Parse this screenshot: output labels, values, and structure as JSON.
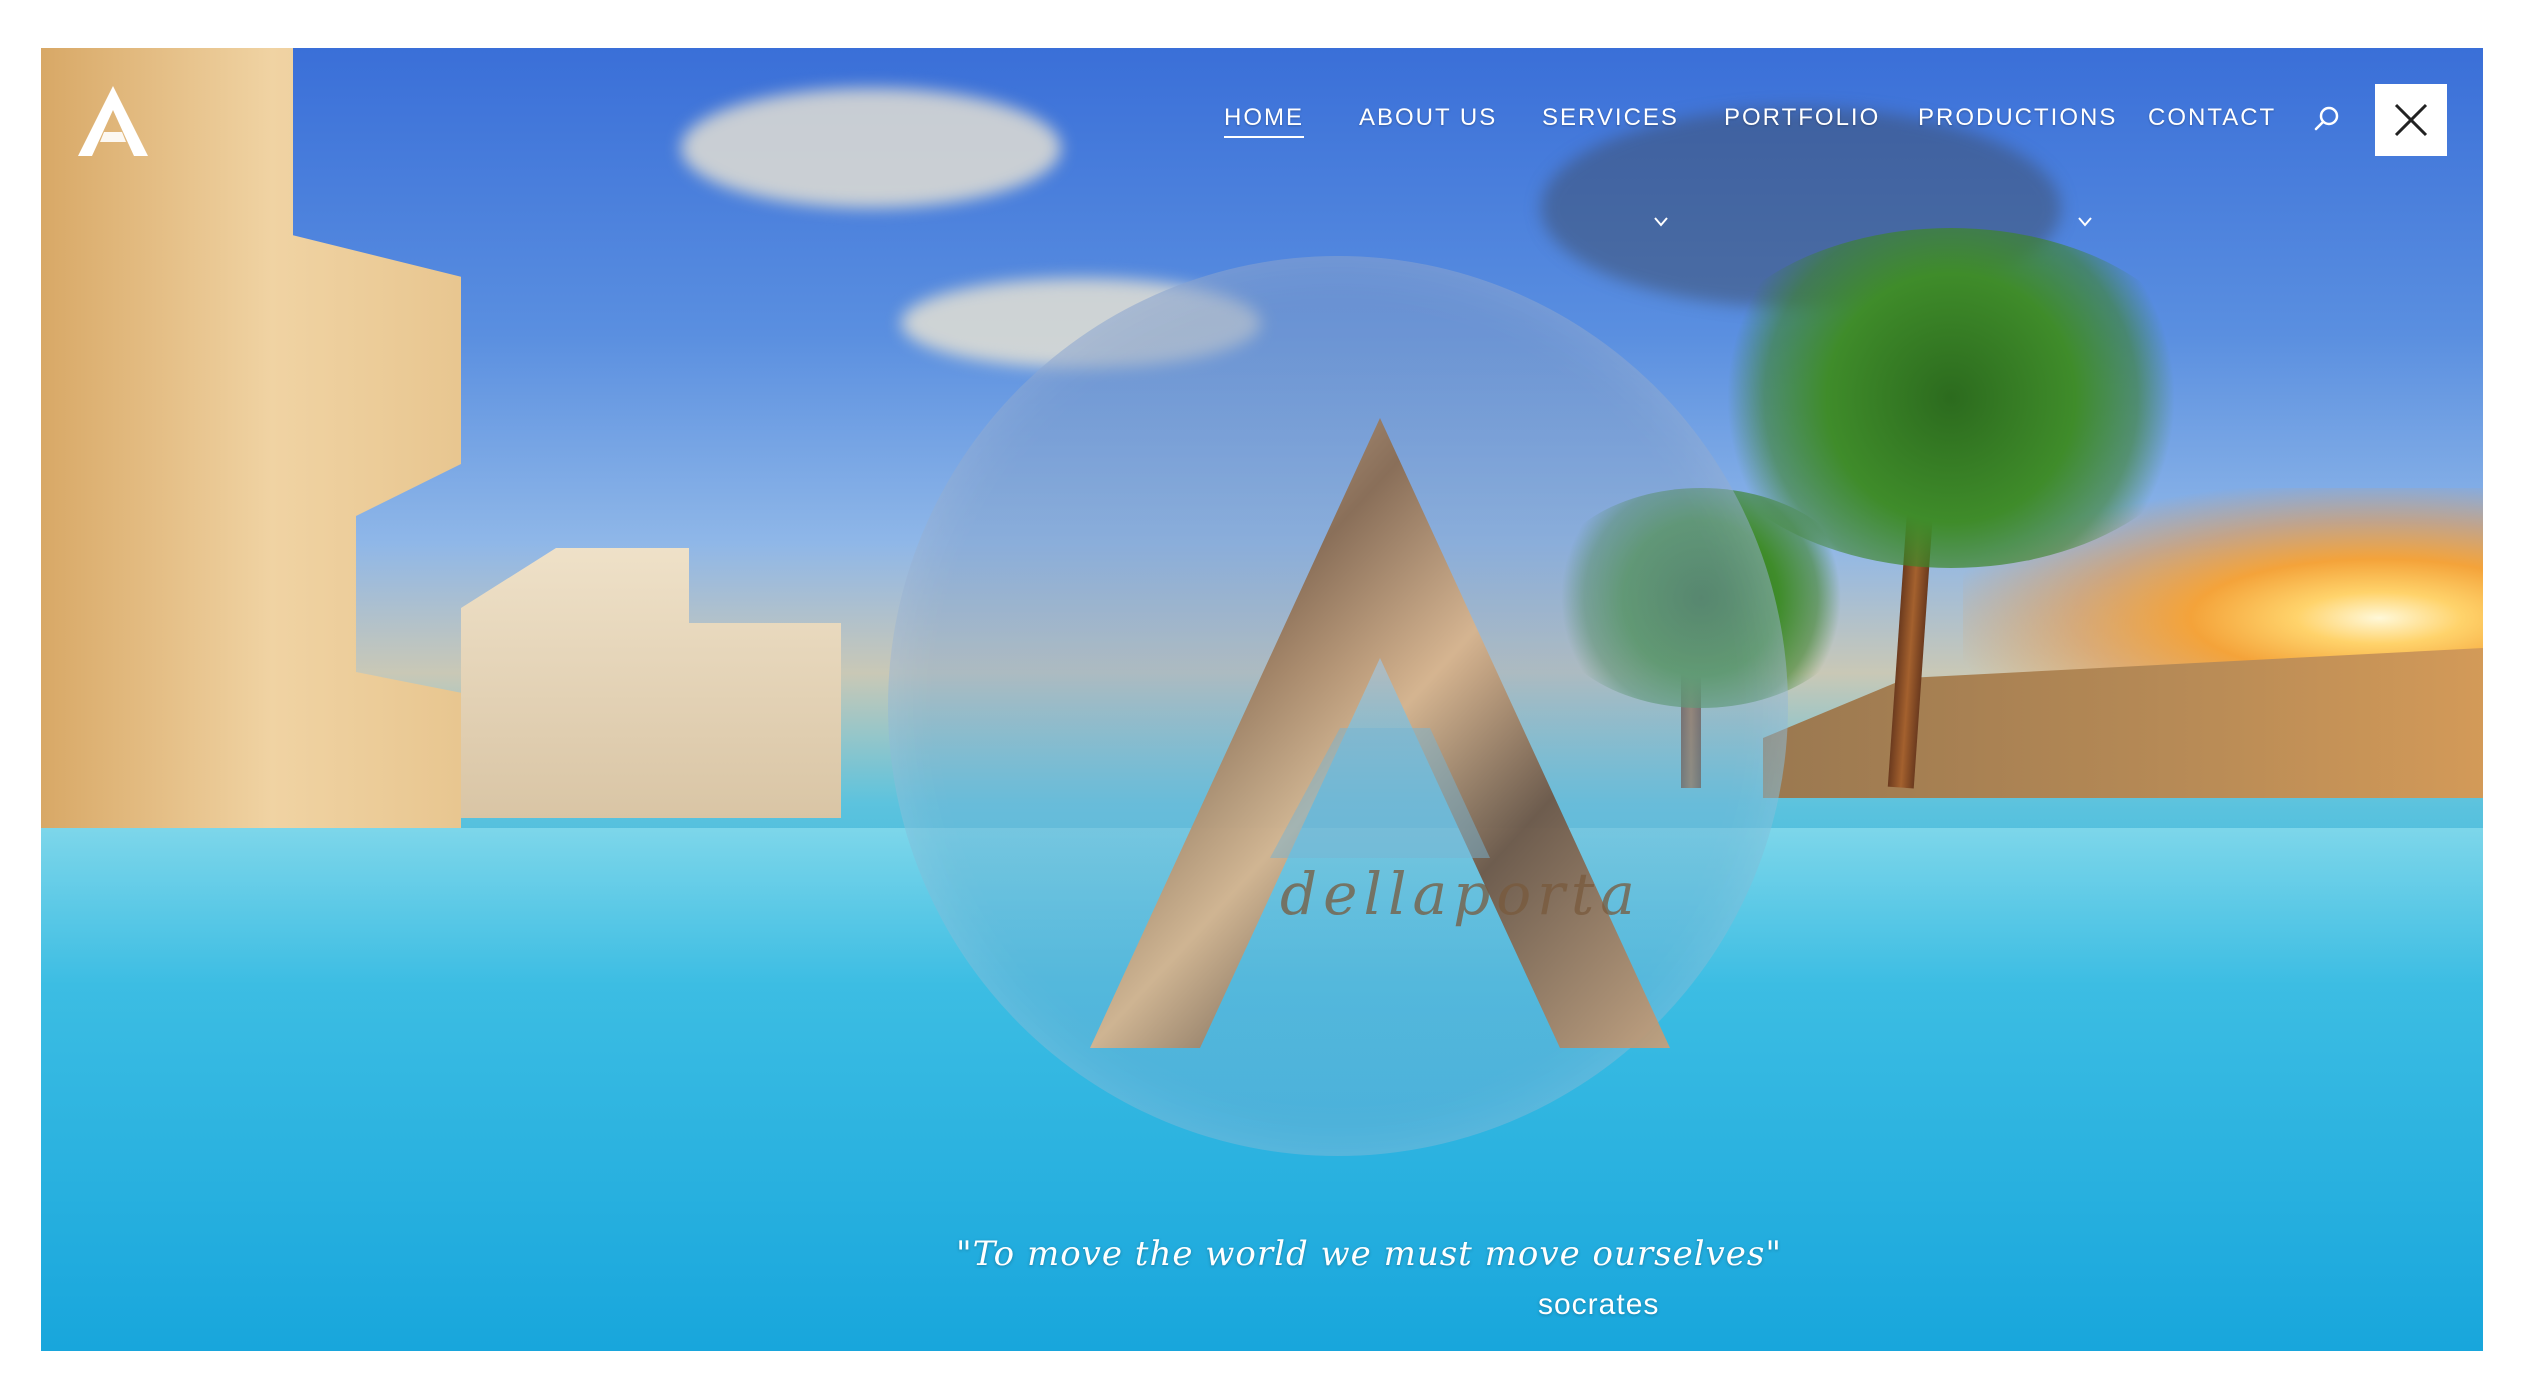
{
  "brand": {
    "logo_icon": "a-letter-logo-icon",
    "signature_text": "dellaporta"
  },
  "nav": {
    "items": [
      {
        "label": "HOME",
        "active": true,
        "has_dropdown": false
      },
      {
        "label": "ABOUT US",
        "active": false,
        "has_dropdown": false
      },
      {
        "label": "SERVICES",
        "active": false,
        "has_dropdown": true
      },
      {
        "label": "PORTFOLIO",
        "active": false,
        "has_dropdown": false
      },
      {
        "label": "PRODUCTIONS",
        "active": false,
        "has_dropdown": true
      },
      {
        "label": "CONTACT",
        "active": false,
        "has_dropdown": false
      }
    ],
    "search_icon": "search-icon",
    "close_icon": "close-icon"
  },
  "hero": {
    "quote": "\"To move the world we must move ourselves\"",
    "author": "socrates"
  },
  "colors": {
    "accent": "#ffffff",
    "sky": "#3a6fd8",
    "pool": "#1aa4db"
  }
}
